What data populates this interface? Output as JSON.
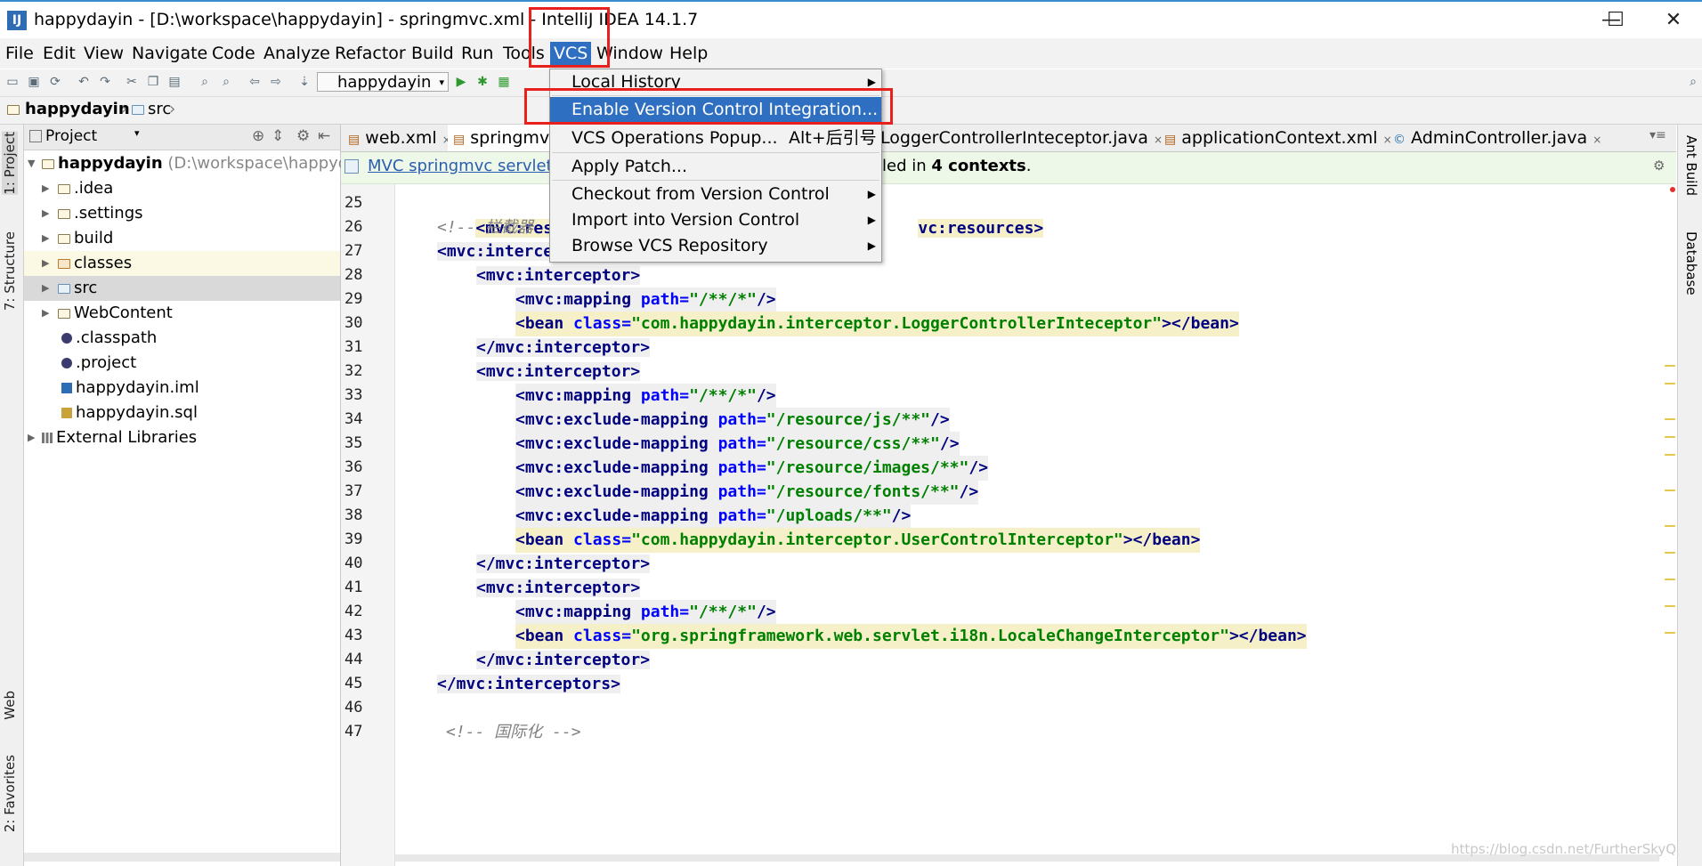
{
  "window": {
    "title": "happydayin - [D:\\workspace\\happydayin] - springmvc.xml - IntelliJ IDEA 14.1.7",
    "minimize": "—",
    "maximize": "☐",
    "close": "✕"
  },
  "menubar": {
    "items": [
      "File",
      "Edit",
      "View",
      "Navigate",
      "Code",
      "Analyze",
      "Refactor",
      "Build",
      "Run",
      "Tools",
      "VCS",
      "Window",
      "Help"
    ]
  },
  "toolbar": {
    "run_config": "happydayin"
  },
  "navbar": {
    "project": "happydayin",
    "folder": "src"
  },
  "left_strip": {
    "tabs": [
      "1: Project",
      "7: Structure",
      "Web",
      "2: Favorites"
    ]
  },
  "right_strip": {
    "tabs": [
      "Ant Build",
      "Database"
    ]
  },
  "project_panel": {
    "title": "Project",
    "root_name": "happydayin",
    "root_path": "(D:\\workspace\\happydayin)",
    "items": [
      ".idea",
      ".settings",
      "build",
      "classes",
      "src",
      "WebContent",
      ".classpath",
      ".project",
      "happydayin.iml",
      "happydayin.sql",
      "External Libraries"
    ]
  },
  "editor_tabs": [
    "web.xml",
    "springmvc.xml",
    "LoggerControllerInteceptor.java",
    "applicationContext.xml",
    "AdminController.java"
  ],
  "banner": {
    "link": "MVC springmvc servlet",
    "text_prefix": "led in ",
    "count": "4 contexts",
    "text_suffix": "."
  },
  "vcs_menu": {
    "local_history": "Local History",
    "enable_vci": "Enable Version Control Integration...",
    "vcs_popup": "VCS Operations Popup...",
    "vcs_popup_shortcut": "Alt+后引号",
    "apply_patch": "Apply Patch...",
    "checkout": "Checkout from Version Control",
    "import": "Import into Version Control",
    "browse": "Browse VCS Repository"
  },
  "code_lines": {
    "n25": "25",
    "n26": "26",
    "n27": "27",
    "n28": "28",
    "n29": "29",
    "n30": "30",
    "n31": "31",
    "n32": "32",
    "n33": "33",
    "n34": "34",
    "n35": "35",
    "n36": "36",
    "n37": "37",
    "n38": "38",
    "n39": "39",
    "n40": "40",
    "n41": "41",
    "n42": "42",
    "n43": "43",
    "n44": "44",
    "n45": "45",
    "n46": "46",
    "n47": "47"
  },
  "code": {
    "l25_a": "<mvc:resourc",
    "l25_b": "vc:resources>",
    "l26": "<!-- 拦截器",
    "l27": "<mvc:interceptors>",
    "l28": "<mvc:interceptor>",
    "l29_tag": "<mvc:mapping",
    "l29_attr": "path=",
    "l29_val": "\"/**/*\"",
    "l29_end": "/>",
    "l30_tag": "<bean",
    "l30_attr": "class=",
    "l30_val": "\"com.happydayin.interceptor.LoggerControllerInteceptor\"",
    "l30_end": "></bean>",
    "l31": "</mvc:interceptor>",
    "l32": "<mvc:interceptor>",
    "l33_tag": "<mvc:mapping",
    "l33_attr": "path=",
    "l33_val": "\"/**/*\"",
    "l33_end": "/>",
    "l34_tag": "<mvc:exclude-mapping",
    "l34_attr": "path=",
    "l34_val": "\"/resource/js/**\"",
    "l34_end": "/>",
    "l35_tag": "<mvc:exclude-mapping",
    "l35_attr": "path=",
    "l35_val": "\"/resource/css/**\"",
    "l35_end": "/>",
    "l36_tag": "<mvc:exclude-mapping",
    "l36_attr": "path=",
    "l36_val": "\"/resource/images/**\"",
    "l36_end": "/>",
    "l37_tag": "<mvc:exclude-mapping",
    "l37_attr": "path=",
    "l37_val": "\"/resource/fonts/**\"",
    "l37_end": "/>",
    "l38_tag": "<mvc:exclude-mapping",
    "l38_attr": "path=",
    "l38_val": "\"/uploads/**\"",
    "l38_end": "/>",
    "l39_tag": "<bean",
    "l39_attr": "class=",
    "l39_val": "\"com.happydayin.interceptor.UserControlInterceptor\"",
    "l39_end": "></bean>",
    "l40": "</mvc:interceptor>",
    "l41": "<mvc:interceptor>",
    "l42_tag": "<mvc:mapping",
    "l42_attr": "path=",
    "l42_val": "\"/**/*\"",
    "l42_end": "/>",
    "l43_tag": "<bean",
    "l43_attr": "class=",
    "l43_val": "\"org.springframework.web.servlet.i18n.LocaleChangeInterceptor\"",
    "l43_end": "></bean>",
    "l44": "</mvc:interceptor>",
    "l45": "</mvc:interceptors>",
    "l47": "<!-- 国际化 -->"
  },
  "watermark": "https://blog.csdn.net/FurtherSkyQ",
  "colors": {
    "menu_highlight": "#2f6fc1",
    "red_annotation": "#e8201e",
    "xml_tag": "#000080",
    "xml_attr": "#0000ff",
    "xml_value": "#008000"
  }
}
